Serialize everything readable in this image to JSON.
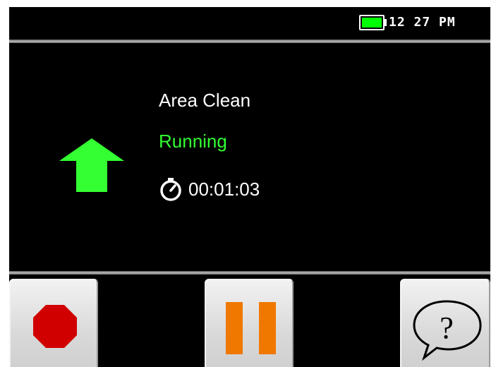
{
  "status_bar": {
    "battery_level": "full",
    "battery_color": "#00ff00",
    "time": "12 27 PM"
  },
  "job": {
    "title": "Area Clean",
    "status": "Running",
    "status_color": "#33ff33",
    "elapsed": "00:01:03",
    "direction_icon": "up-arrow-icon",
    "direction_color": "#33ff33"
  },
  "controls": {
    "stop": {
      "icon": "stop-icon",
      "color": "#d00000"
    },
    "pause": {
      "icon": "pause-icon",
      "color": "#f07800"
    },
    "help": {
      "icon": "help-icon",
      "glyph": "?"
    }
  }
}
